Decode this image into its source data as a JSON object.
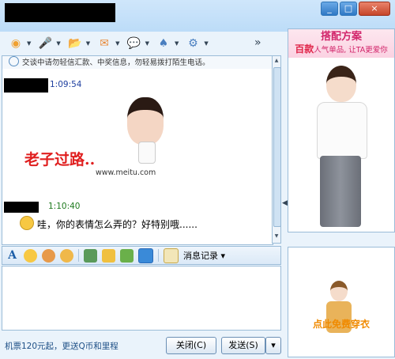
{
  "window": {
    "buttons": {
      "minimize": "_",
      "maximize": "□",
      "close": "×"
    }
  },
  "toolbar": {
    "items": [
      {
        "icon": "webcam-icon",
        "glyph": "◉",
        "color": "#f0a030"
      },
      {
        "icon": "microphone-icon",
        "glyph": "🎤",
        "color": "#5a8fd0"
      },
      {
        "icon": "folder-transfer-icon",
        "glyph": "📂",
        "color": "#4a8fd8"
      },
      {
        "icon": "email-icon",
        "glyph": "✉",
        "color": "#e88a3a"
      },
      {
        "icon": "chat-bubble-icon",
        "glyph": "💬",
        "color": "#e8a030"
      },
      {
        "icon": "app-icon",
        "glyph": "♠",
        "color": "#4a7fc0"
      },
      {
        "icon": "settings-icon",
        "glyph": "⚙",
        "color": "#4a7fc0"
      }
    ],
    "more": "»"
  },
  "chat": {
    "notice": "交谈中请勿轻信汇款、中奖信息，勿轻易拨打陌生电话。",
    "msg1_time": "1:09:54",
    "sticker_text": "老子过路..",
    "sticker_site": "www.meitu.com",
    "msg2_time": "1:10:40",
    "msg2_text": "哇，你的表情怎么弄的？好特别哦......"
  },
  "format_bar": {
    "font_label": "A",
    "history": "消息记录",
    "history_arrow": "▾"
  },
  "bottom": {
    "promo": "机票120元起，更送Q币和里程",
    "close_button": "关闭(C)",
    "send_button": "发送(S)",
    "send_arrow": "▾"
  },
  "side_ad": {
    "title": "搭配方案",
    "sub_bold": "百款",
    "sub_rest": "人气单品, 让TA更爱你"
  },
  "side_ad2": {
    "text": "点此免费穿衣"
  }
}
